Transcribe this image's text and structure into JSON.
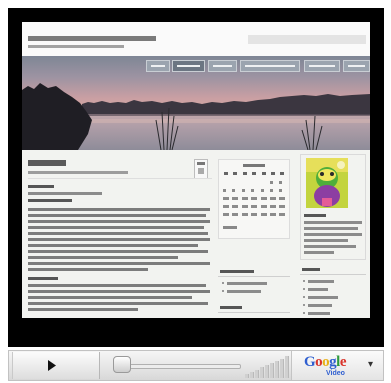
{
  "player": {
    "progress": 0,
    "logo": {
      "wordmark": "Google",
      "wordmark_colors": [
        "#2f5fd0",
        "#d9342b",
        "#e8b21a",
        "#2f5fd0",
        "#2e9a3c",
        "#d9342b"
      ],
      "subtitle": "Video"
    },
    "icons": {
      "play": "play-icon",
      "volume": "volume-icon",
      "menu": "chevron-down-icon"
    }
  },
  "colors": {
    "video_frame": "#000000",
    "control_bar": "#e3e3e3",
    "nav_tab": "#9ba4af",
    "nav_tab_active": "#6c7683"
  }
}
